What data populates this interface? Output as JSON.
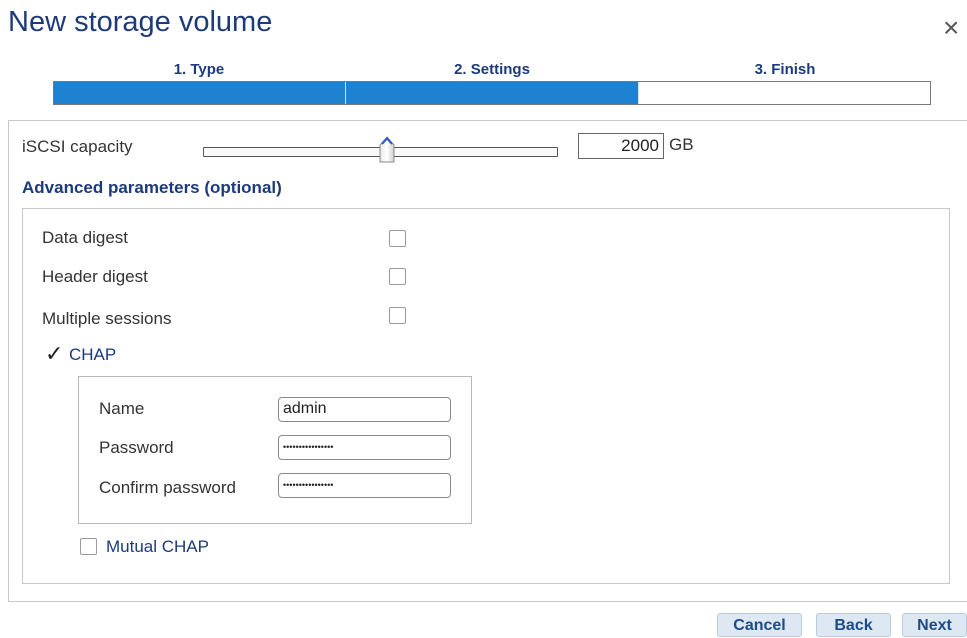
{
  "dialog": {
    "title": "New storage volume",
    "close_glyph": "×"
  },
  "steps": [
    {
      "label": "1. Type",
      "complete": true
    },
    {
      "label": "2. Settings",
      "complete": true
    },
    {
      "label": "3. Finish",
      "complete": false
    }
  ],
  "capacity": {
    "label": "iSCSI capacity",
    "value": "2000",
    "unit": "GB"
  },
  "advanced": {
    "title": "Advanced parameters (optional)",
    "options": [
      {
        "label": "Data digest",
        "checked": false
      },
      {
        "label": "Header digest",
        "checked": false
      },
      {
        "label": "Multiple sessions",
        "checked": false
      }
    ],
    "chap": {
      "label": "CHAP",
      "checked": true,
      "check_glyph": "✓",
      "name_label": "Name",
      "name_value": "admin",
      "password_label": "Password",
      "password_value": "••••••••••••••••",
      "confirm_label": "Confirm password",
      "confirm_value": "••••••••••••••••"
    },
    "mutual_chap": {
      "label": "Mutual CHAP",
      "checked": false
    }
  },
  "buttons": {
    "cancel": "Cancel",
    "back": "Back",
    "next": "Next"
  },
  "colors": {
    "accent": "#1f82d0",
    "heading": "#1d3a7a"
  }
}
